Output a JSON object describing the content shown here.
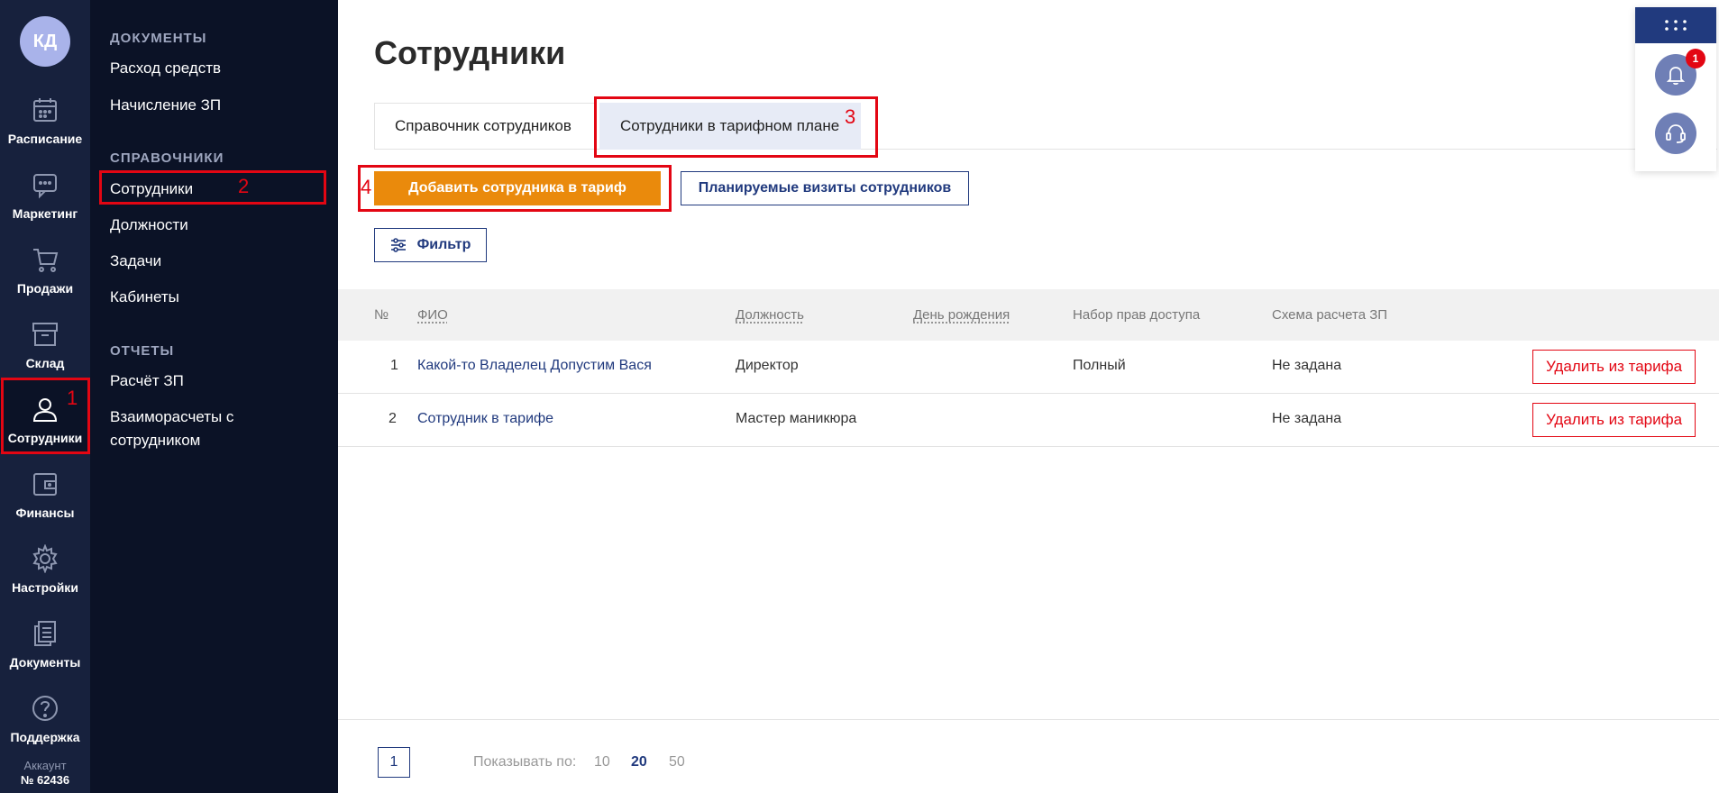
{
  "rail": {
    "avatar": "КД",
    "items": [
      {
        "label": "Расписание",
        "icon": "calendar-icon"
      },
      {
        "label": "Маркетинг",
        "icon": "chat-icon"
      },
      {
        "label": "Продажи",
        "icon": "cart-icon"
      },
      {
        "label": "Склад",
        "icon": "archive-icon"
      },
      {
        "label": "Сотрудники",
        "icon": "user-icon"
      },
      {
        "label": "Финансы",
        "icon": "wallet-icon"
      },
      {
        "label": "Настройки",
        "icon": "gear-icon"
      },
      {
        "label": "Документы",
        "icon": "documents-icon"
      },
      {
        "label": "Поддержка",
        "icon": "help-icon"
      }
    ],
    "account_label": "Аккаунт",
    "account_number": "№ 62436"
  },
  "subnav": {
    "section_documents": "ДОКУМЕНТЫ",
    "doc_links": [
      "Расход средств",
      "Начисление ЗП"
    ],
    "section_references": "СПРАВОЧНИКИ",
    "ref_links": [
      "Сотрудники",
      "Должности",
      "Задачи",
      "Кабинеты"
    ],
    "section_reports": "ОТЧЕТЫ",
    "report_links": [
      "Расчёт ЗП",
      "Взаиморасчеты с сотрудником"
    ]
  },
  "annotations": [
    "1",
    "2",
    "3",
    "4"
  ],
  "page": {
    "title": "Сотрудники",
    "tabs": [
      "Справочник сотрудников",
      "Сотрудники в тарифном плане"
    ],
    "add_button": "Добавить сотрудника в тариф",
    "planned_button": "Планируемые визиты сотрудников",
    "filter_button": "Фильтр"
  },
  "table": {
    "headers": [
      "№",
      "ФИО",
      "Должность",
      "День рождения",
      "Набор прав доступа",
      "Схема расчета ЗП"
    ],
    "rows": [
      {
        "n": "1",
        "name": "Какой-то Владелец Допустим Вася",
        "position": "Директор",
        "birthday": "",
        "rights": "Полный",
        "scheme": "Не задана",
        "action": "Удалить из тарифа"
      },
      {
        "n": "2",
        "name": "Сотрудник в тарифе",
        "position": "Мастер маникюра",
        "birthday": "",
        "rights": "",
        "scheme": "Не задана",
        "action": "Удалить из тарифа"
      }
    ]
  },
  "pagination": {
    "current_page": "1",
    "show_label": "Показывать по:",
    "sizes": [
      "10",
      "20",
      "50"
    ],
    "selected_size": "20"
  },
  "floating": {
    "notification_count": "1"
  },
  "colors": {
    "accent_orange": "#ea8a0c",
    "navy": "#213a7e",
    "sidebar": "#17213d",
    "annotation_red": "#e30613"
  }
}
